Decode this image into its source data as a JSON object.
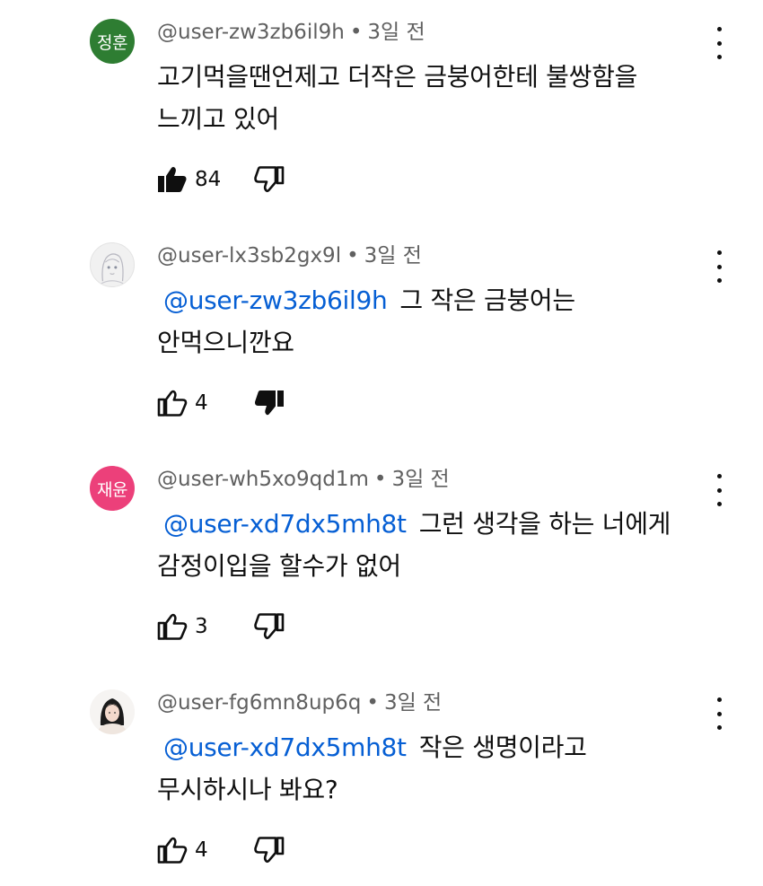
{
  "comments": [
    {
      "avatar_text": "정훈",
      "avatar_color": "#2e7d32",
      "author": "@user-zw3zb6il9h",
      "time": "3일 전",
      "mention": "",
      "lines": [
        "고기먹을땐언제고 더작은 금붕어한테 불쌍함을",
        "느끼고 있어"
      ],
      "likes": "84",
      "liked": true,
      "disliked": false
    },
    {
      "avatar_text": "",
      "avatar_icon": "sketch-avatar-icon",
      "author": "@user-lx3sb2gx9l",
      "time": "3일 전",
      "mention": "@user-zw3zb6il9h",
      "lines": [
        "그 작은 금붕어는",
        "안먹으니깐요"
      ],
      "likes": "4",
      "liked": false,
      "disliked": true
    },
    {
      "avatar_text": "재윤",
      "avatar_color": "#ec407a",
      "author": "@user-wh5xo9qd1m",
      "time": "3일 전",
      "mention": "@user-xd7dx5mh8t",
      "lines": [
        "그런 생각을 하는 너에게",
        "감정이입을 할수가 없어"
      ],
      "likes": "3",
      "liked": false,
      "disliked": false
    },
    {
      "avatar_text": "",
      "avatar_icon": "photo-avatar-icon",
      "author": "@user-fg6mn8up6q",
      "time": "3일 전",
      "mention": "@user-xd7dx5mh8t",
      "lines": [
        "작은 생명이라고",
        "무시하시나 봐요?"
      ],
      "likes": "4",
      "liked": false,
      "disliked": false
    }
  ],
  "colors": {
    "mention": "#065fd4",
    "meta": "#606060",
    "text": "#0f0f0f"
  }
}
